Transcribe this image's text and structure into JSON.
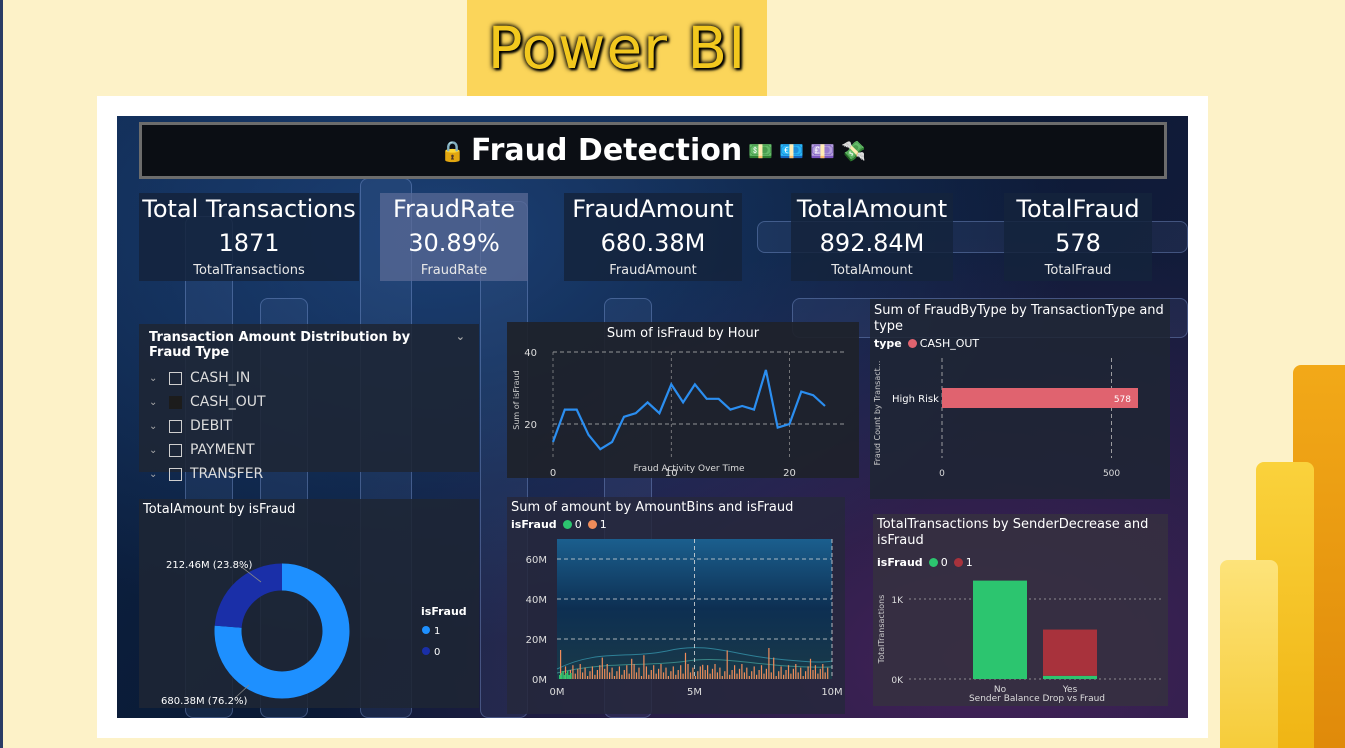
{
  "logo": {
    "text": "Power BI"
  },
  "dashboard": {
    "title": "Fraud Detection",
    "title_icons": [
      "lock-icon",
      "money-icon",
      "euro-icon",
      "pound-icon",
      "money-wings-icon"
    ]
  },
  "cards": [
    {
      "label": "Total Transactions",
      "value": "1871",
      "sub": "TotalTransactions"
    },
    {
      "label": "FraudRate",
      "value": "30.89%",
      "sub": "FraudRate"
    },
    {
      "label": "FraudAmount",
      "value": "680.38M",
      "sub": "FraudAmount"
    },
    {
      "label": "TotalAmount",
      "value": "892.84M",
      "sub": "TotalAmount"
    },
    {
      "label": "TotalFraud",
      "value": "578",
      "sub": "TotalFraud"
    }
  ],
  "slicer": {
    "title": "Transaction Amount Distribution by Fraud Type",
    "items": [
      "CASH_IN",
      "CASH_OUT",
      "DEBIT",
      "PAYMENT",
      "TRANSFER"
    ],
    "selected": "CASH_OUT"
  },
  "colors": {
    "blue": "#1e90ff",
    "dark_blue": "#1a2fa8",
    "green": "#2cc56f",
    "orange": "#f08c5a",
    "red_bar": "#e0636f",
    "dark_red": "#a8323c",
    "line": "#2b8ef0"
  },
  "chart_data": [
    {
      "type": "line",
      "title": "Sum of isFraud by Hour",
      "xlabel": "Fraud Activity Over Time",
      "ylabel": "Sum of isFraud",
      "x": [
        0,
        1,
        2,
        3,
        4,
        5,
        6,
        7,
        8,
        9,
        10,
        11,
        12,
        13,
        14,
        15,
        16,
        17,
        18,
        19,
        20,
        21,
        22,
        23
      ],
      "values": [
        15,
        24,
        24,
        17,
        13,
        15,
        22,
        23,
        26,
        23,
        31,
        26,
        31,
        27,
        27,
        24,
        25,
        24,
        35,
        19,
        20,
        29,
        28,
        25
      ],
      "xticks": [
        0,
        10,
        20
      ],
      "yticks": [
        20,
        40
      ],
      "ylim": [
        10,
        40
      ]
    },
    {
      "type": "bar",
      "title": "Sum of FraudByType by TransactionType and type",
      "legend_title": "type",
      "series_name": "CASH_OUT",
      "ylabel": "Fraud Count by Transact...",
      "categories": [
        "High Risk"
      ],
      "values": [
        578
      ],
      "xticks": [
        0,
        500
      ],
      "xlim": [
        0,
        578
      ]
    },
    {
      "type": "pie",
      "title": "TotalAmount by isFraud",
      "legend_title": "isFraud",
      "labels": [
        "1",
        "0"
      ],
      "values": [
        680.38,
        212.46
      ],
      "data_labels": [
        "680.38M (76.2%)",
        "212.46M (23.8%)"
      ]
    },
    {
      "type": "bar",
      "title": "Sum of amount by AmountBins and isFraud",
      "legend_title": "isFraud",
      "legend": [
        "0",
        "1"
      ],
      "xticks": [
        "0M",
        "5M",
        "10M"
      ],
      "yticks": [
        "0M",
        "20M",
        "40M",
        "60M"
      ],
      "ylim": [
        0,
        70
      ]
    },
    {
      "type": "bar",
      "title": "TotalTransactions by SenderDecrease and isFraud",
      "legend_title": "isFraud",
      "xlabel": "Sender Balance Drop vs Fraud",
      "ylabel": "TotalTransactions",
      "categories": [
        "No",
        "Yes"
      ],
      "series": [
        {
          "name": "0",
          "values": [
            1230,
            40
          ]
        },
        {
          "name": "1",
          "values": [
            0,
            578
          ]
        }
      ],
      "yticks": [
        "0K",
        "1K"
      ],
      "ylim": [
        0,
        1250
      ]
    }
  ]
}
